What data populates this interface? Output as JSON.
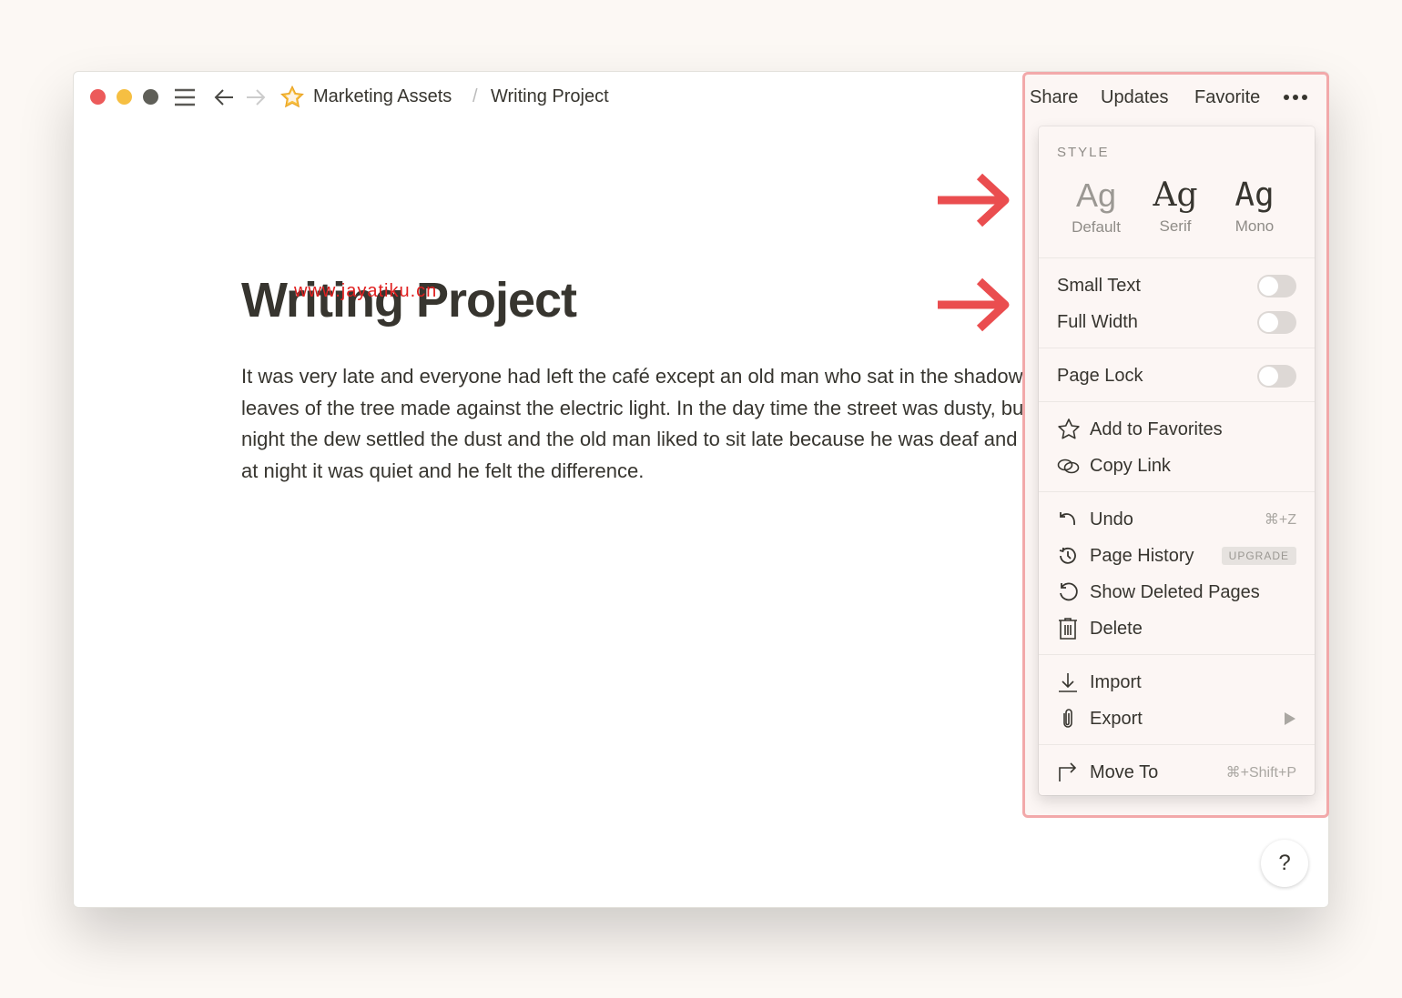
{
  "breadcrumb": {
    "items": [
      "Marketing Assets",
      "Writing Project"
    ],
    "separator": "/"
  },
  "topbar": {
    "share": "Share",
    "updates": "Updates",
    "favorite": "Favorite"
  },
  "page": {
    "title": "Writing Project",
    "watermark": "www.jayatiku.cn",
    "body": [
      "It was very late and everyone had left the café except an old man who sat in the shadow the",
      "leaves of the tree made against the electric light. In the day time the street was dusty, but at",
      "night the dew settled the dust and the old man liked to sit late because he was deaf and now",
      "at night it was quiet and he felt the difference."
    ]
  },
  "menu": {
    "style_heading": "STYLE",
    "styles": [
      {
        "sample": "Ag",
        "name": "Default"
      },
      {
        "sample": "Ag",
        "name": "Serif"
      },
      {
        "sample": "Ag",
        "name": "Mono"
      }
    ],
    "toggles": [
      {
        "label": "Small Text",
        "on": false
      },
      {
        "label": "Full Width",
        "on": false
      },
      {
        "label": "Page Lock",
        "on": false
      }
    ],
    "items": [
      {
        "label": "Add to Favorites",
        "icon": "star-icon"
      },
      {
        "label": "Copy Link",
        "icon": "link-icon"
      },
      {
        "label": "Undo",
        "icon": "undo-icon",
        "shortcut": "⌘+Z"
      },
      {
        "label": "Page History",
        "icon": "history-icon",
        "badge": "UPGRADE"
      },
      {
        "label": "Show Deleted Pages",
        "icon": "restore-icon"
      },
      {
        "label": "Delete",
        "icon": "trash-icon"
      },
      {
        "label": "Import",
        "icon": "import-icon"
      },
      {
        "label": "Export",
        "icon": "paperclip-icon"
      },
      {
        "label": "Move To",
        "icon": "move-icon",
        "shortcut": "⌘+Shift+P"
      }
    ]
  },
  "help": "?",
  "colors": {
    "highlight": "#f2a9aa",
    "arrow": "#ea4d4f",
    "close": "#ec5a5a",
    "minimize": "#f6bf42",
    "zoom": "#5f5f58"
  }
}
